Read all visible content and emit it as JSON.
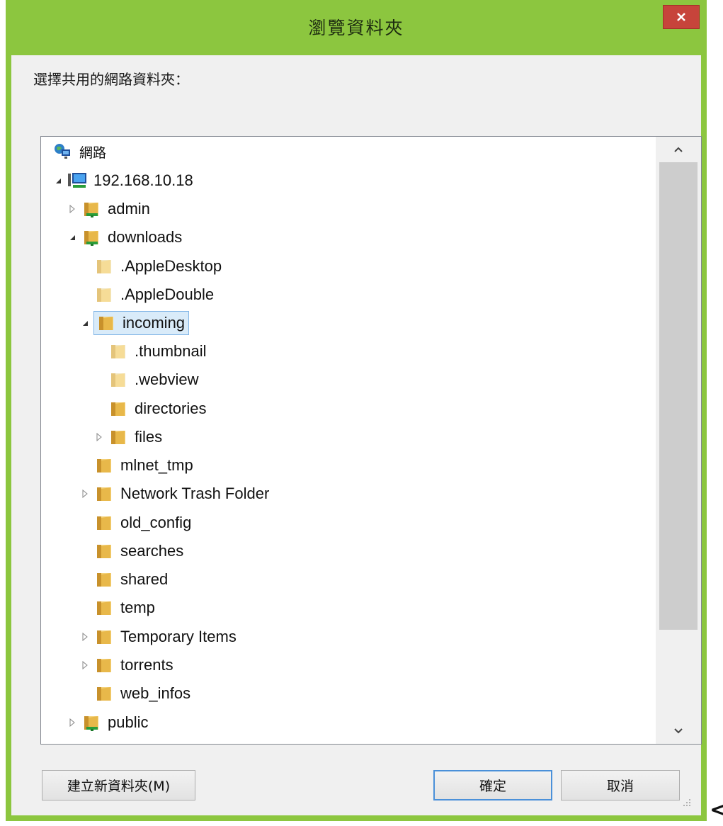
{
  "window": {
    "title": "瀏覽資料夾",
    "close_label": "✕",
    "instruction": "選擇共用的網路資料夾："
  },
  "tree": {
    "nodes": [
      {
        "label": "網路",
        "type": "network",
        "expander": "none"
      },
      {
        "label": "192.168.10.18",
        "type": "computer",
        "expander": "expanded"
      },
      {
        "label": "admin",
        "type": "share",
        "expander": "collapsed"
      },
      {
        "label": "downloads",
        "type": "share",
        "expander": "expanded"
      },
      {
        "label": ".AppleDesktop",
        "type": "folder-light",
        "expander": "none"
      },
      {
        "label": ".AppleDouble",
        "type": "folder-light",
        "expander": "none"
      },
      {
        "label": "incoming",
        "type": "folder",
        "expander": "expanded",
        "selected": true
      },
      {
        "label": ".thumbnail",
        "type": "folder-light",
        "expander": "none"
      },
      {
        "label": ".webview",
        "type": "folder-light",
        "expander": "none"
      },
      {
        "label": "directories",
        "type": "folder",
        "expander": "none"
      },
      {
        "label": "files",
        "type": "folder",
        "expander": "collapsed"
      },
      {
        "label": "mlnet_tmp",
        "type": "folder",
        "expander": "none"
      },
      {
        "label": "Network Trash Folder",
        "type": "folder",
        "expander": "collapsed"
      },
      {
        "label": "old_config",
        "type": "folder",
        "expander": "none"
      },
      {
        "label": "searches",
        "type": "folder",
        "expander": "none"
      },
      {
        "label": "shared",
        "type": "folder",
        "expander": "none"
      },
      {
        "label": "temp",
        "type": "folder",
        "expander": "none"
      },
      {
        "label": "Temporary Items",
        "type": "folder",
        "expander": "collapsed"
      },
      {
        "label": "torrents",
        "type": "folder",
        "expander": "collapsed"
      },
      {
        "label": "web_infos",
        "type": "folder",
        "expander": "none"
      },
      {
        "label": "public",
        "type": "share",
        "expander": "collapsed"
      }
    ]
  },
  "buttons": {
    "new_folder": "建立新資料夾(M)",
    "ok": "確定",
    "cancel": "取消"
  },
  "stray_char": "<",
  "colors": {
    "frame": "#8cc63f",
    "close": "#c7443b",
    "selection_fill": "#d9ebf9",
    "selection_border": "#7fb4e6",
    "folder": "#e8b84a"
  }
}
